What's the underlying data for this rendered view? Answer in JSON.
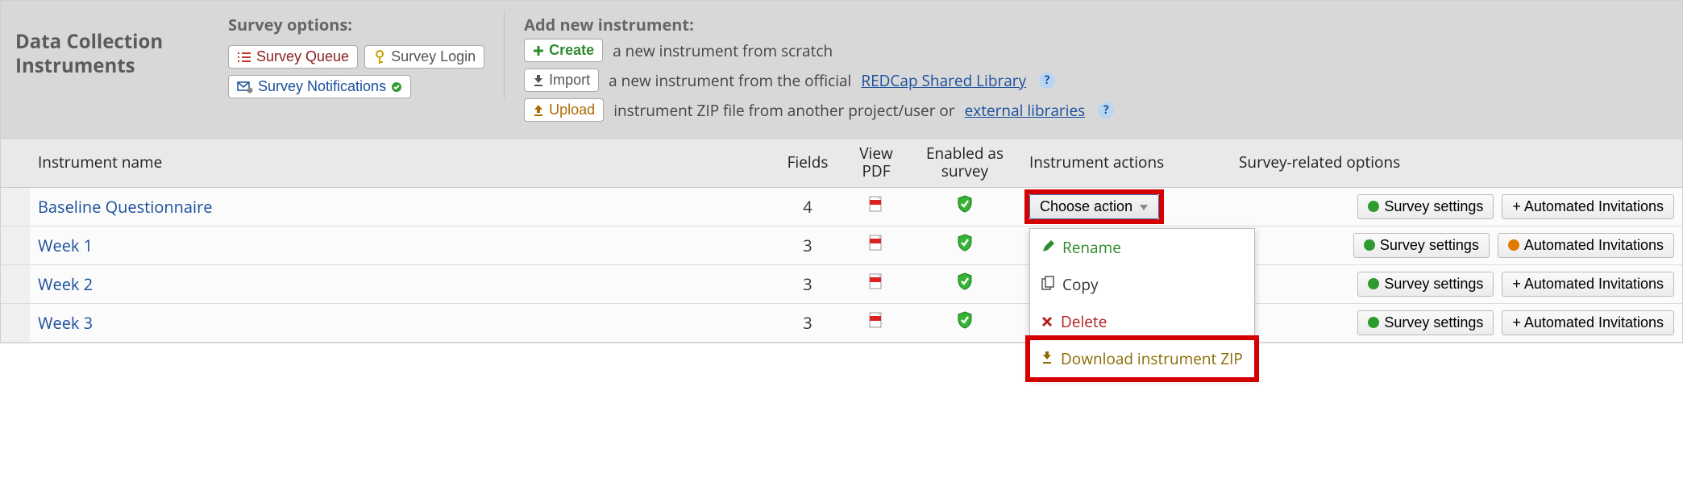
{
  "title": "Data Collection Instruments",
  "survey_options": {
    "label": "Survey options:",
    "queue": "Survey Queue",
    "login": "Survey Login",
    "notifications": "Survey Notifications"
  },
  "add_new": {
    "label": "Add new instrument:",
    "create": "Create",
    "create_desc": "a new instrument from scratch",
    "import": "Import",
    "import_desc_pre": "a new instrument from the official",
    "import_link": "REDCap Shared Library",
    "upload": "Upload",
    "upload_desc_pre": "instrument ZIP file from another project/user or",
    "upload_link": "external libraries"
  },
  "columns": {
    "name": "Instrument name",
    "fields": "Fields",
    "pdf": "View PDF",
    "enabled": "Enabled as survey",
    "actions": "Instrument actions",
    "survey_opts": "Survey-related options"
  },
  "action_button": "Choose action",
  "survey_settings_label": "Survey settings",
  "auto_inv_plus": "+ Automated Invitations",
  "auto_inv_dot": "Automated Invitations",
  "rows": [
    {
      "name": "Baseline Questionnaire",
      "fields": "4",
      "inv_variant": "plus"
    },
    {
      "name": "Week 1",
      "fields": "3",
      "inv_variant": "dot"
    },
    {
      "name": "Week 2",
      "fields": "3",
      "inv_variant": "plus"
    },
    {
      "name": "Week 3",
      "fields": "3",
      "inv_variant": "plus"
    }
  ],
  "dropdown": {
    "rename": "Rename",
    "copy": "Copy",
    "delete": "Delete",
    "download": "Download instrument ZIP"
  }
}
